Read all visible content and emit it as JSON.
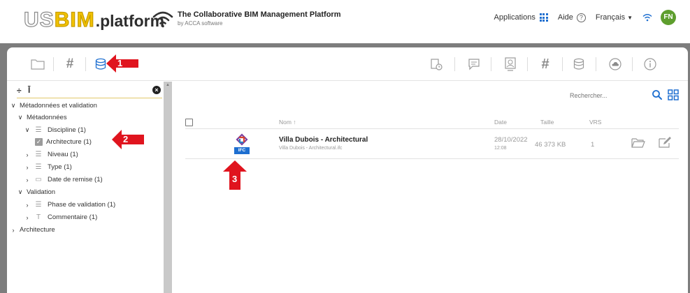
{
  "header": {
    "logo_us": "us",
    "logo_bim": "BIM",
    "logo_platform": ".platform",
    "tagline": "The Collaborative BIM Management Platform",
    "tagline_sub": "by ACCA software",
    "applications_label": "Applications",
    "help_label": "Aide",
    "help_symbol": "?",
    "language_label": "Français",
    "avatar_initials": "FN"
  },
  "sidebar": {
    "tree": [
      {
        "label": "Métadonnées et validation",
        "level": 0,
        "chevron": "down"
      },
      {
        "label": "Métadonnées",
        "level": 1,
        "chevron": "down"
      },
      {
        "label": "Discipline (1)",
        "level": 2,
        "chevron": "down",
        "icon": "list-icon"
      },
      {
        "label": "Architecture (1)",
        "level": 3,
        "checked": true
      },
      {
        "label": "Niveau (1)",
        "level": 2,
        "chevron": "right",
        "icon": "list-icon"
      },
      {
        "label": "Type (1)",
        "level": 2,
        "chevron": "right",
        "icon": "list-icon"
      },
      {
        "label": "Date de remise (1)",
        "level": 2,
        "chevron": "right",
        "icon": "calendar-icon"
      },
      {
        "label": "Validation",
        "level": 1,
        "chevron": "down"
      },
      {
        "label": "Phase de validation (1)",
        "level": 2,
        "chevron": "right",
        "icon": "list-icon"
      },
      {
        "label": "Commentaire (1)",
        "level": 2,
        "chevron": "right",
        "icon": "text-icon"
      },
      {
        "label": "Architecture",
        "level": 0,
        "chevron": "right"
      }
    ]
  },
  "main": {
    "search_placeholder": "Rechercher...",
    "columns": {
      "name": "Nom ↑",
      "date": "Date",
      "size": "Taille",
      "vrs": "VRS"
    },
    "files": [
      {
        "name": "Villa Dubois - Architectural",
        "filename": "Villa Dubois - Architectural.ifc",
        "date": "28/10/2022",
        "time": "12:08",
        "size": "46 373 KB",
        "vrs": "1",
        "badge": "IFC"
      }
    ]
  },
  "annotations": [
    {
      "number": "1"
    },
    {
      "number": "2"
    },
    {
      "number": "3"
    }
  ],
  "colors": {
    "accent_blue": "#1e6fd0",
    "annotation_red": "#e0141e",
    "avatar_green": "#5e9e2e",
    "frame_gray": "#7d7d7d"
  }
}
